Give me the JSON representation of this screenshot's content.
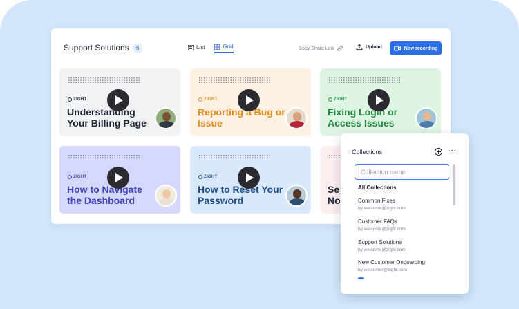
{
  "header": {
    "title": "Support Solutions",
    "count": "6",
    "view_list": "List",
    "view_grid": "Grid",
    "share_link": "Copy Share Link",
    "upload": "Upload",
    "new_recording": "New recording"
  },
  "cards": [
    {
      "brand": "ZIGHT",
      "title": "Understanding Your Billing Page",
      "bg": "#f1f2f4",
      "color": "#1d2433",
      "avatar_bg": "#8fae7a",
      "skin": "#7a5232",
      "shirt": "#2f3a44"
    },
    {
      "brand": "ZIGHT",
      "title": "Reporting a Bug or Issue",
      "bg": "#fdf1e4",
      "color": "#e18a1c",
      "avatar_bg": "#e7d8cf",
      "skin": "#d7a07c",
      "shirt": "#b8263a"
    },
    {
      "brand": "ZIGHT",
      "title": "Fixing Login or Access Issues",
      "bg": "#dff5e3",
      "color": "#1d8a3f",
      "avatar_bg": "#9fc4d9",
      "skin": "#e6b793",
      "shirt": "#4a7fb0"
    },
    {
      "brand": "ZIGHT",
      "title": "How to Navigate the Dashboard",
      "bg": "#d5d8fb",
      "color": "#3f45b8",
      "avatar_bg": "#f1eadf",
      "skin": "#efc8a3",
      "shirt": "#e8e1d6"
    },
    {
      "brand": "ZIGHT",
      "title": "How to Reset Your Password",
      "bg": "#d9e9fb",
      "color": "#1f4e8c",
      "avatar_bg": "#b9cbd8",
      "skin": "#5b3a25",
      "shirt": "#2e4d6e"
    },
    {
      "brand": "",
      "title": "Se No",
      "bg": "#fdeff0",
      "color": "#1d2433",
      "avatar_bg": "",
      "skin": "",
      "shirt": ""
    }
  ],
  "collections": {
    "title": "Collections",
    "search_placeholder": "Collection name",
    "all_label": "All Collections",
    "items": [
      {
        "name": "Common Fixes",
        "by": "by welcome@zight.com"
      },
      {
        "name": "Customer FAQs",
        "by": "by welcome@zight.com"
      },
      {
        "name": "Support Solutions",
        "by": "by welcome@zight.com"
      },
      {
        "name": "New Customer Onboarding",
        "by": "by welcomer@zight.com"
      }
    ]
  }
}
